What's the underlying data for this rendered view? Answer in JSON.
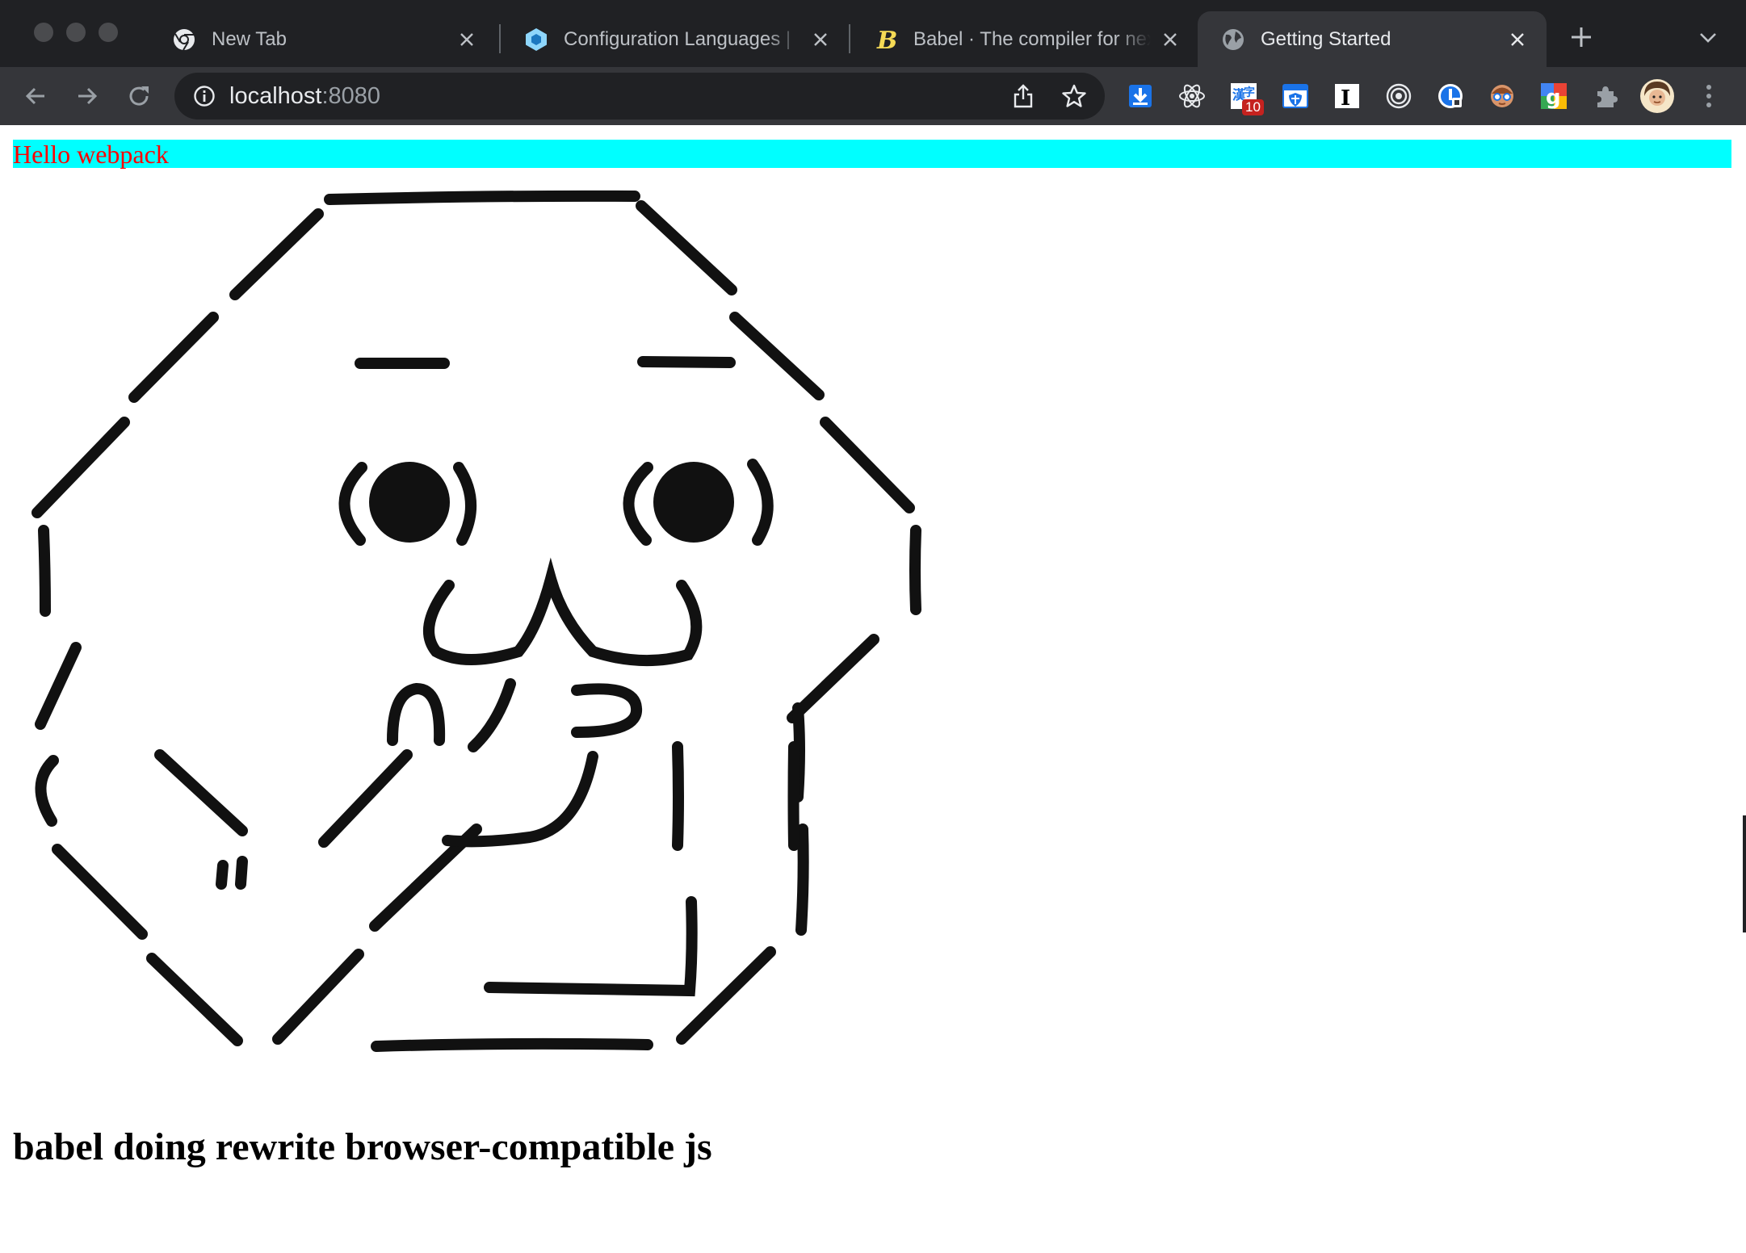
{
  "browser": {
    "tabs": [
      {
        "title": "New Tab",
        "icon": "chrome-icon",
        "active": false
      },
      {
        "title": "Configuration Languages | ",
        "icon": "webpack-icon",
        "active": false
      },
      {
        "title": "Babel · The compiler for next generation JavaScript",
        "icon": "babel-icon",
        "active": false
      },
      {
        "title": "Getting Started",
        "icon": "globe-icon",
        "active": true
      }
    ],
    "address": {
      "host": "localhost",
      "port": ":8080"
    },
    "extensions": [
      {
        "name": "download-extension-icon"
      },
      {
        "name": "react-devtools-icon"
      },
      {
        "name": "translate-extension-icon",
        "badge": "10"
      },
      {
        "name": "shield-extension-icon"
      },
      {
        "name": "instapaper-icon"
      },
      {
        "name": "target-extension-icon"
      },
      {
        "name": "password-manager-icon"
      },
      {
        "name": "avatar-extension-icon"
      },
      {
        "name": "google-extension-icon"
      },
      {
        "name": "extensions-puzzle-icon"
      },
      {
        "name": "profile-avatar"
      },
      {
        "name": "chrome-menu-icon"
      }
    ],
    "colors": {
      "chrome_dark": "#202124",
      "toolbar": "#35363a"
    }
  },
  "page": {
    "hello_text": "Hello webpack",
    "hello_colors": {
      "background": "#00ffff",
      "text": "#ff0000"
    },
    "image": "line-art-face-image",
    "caption": "babel doing rewrite browser-compatible js"
  }
}
